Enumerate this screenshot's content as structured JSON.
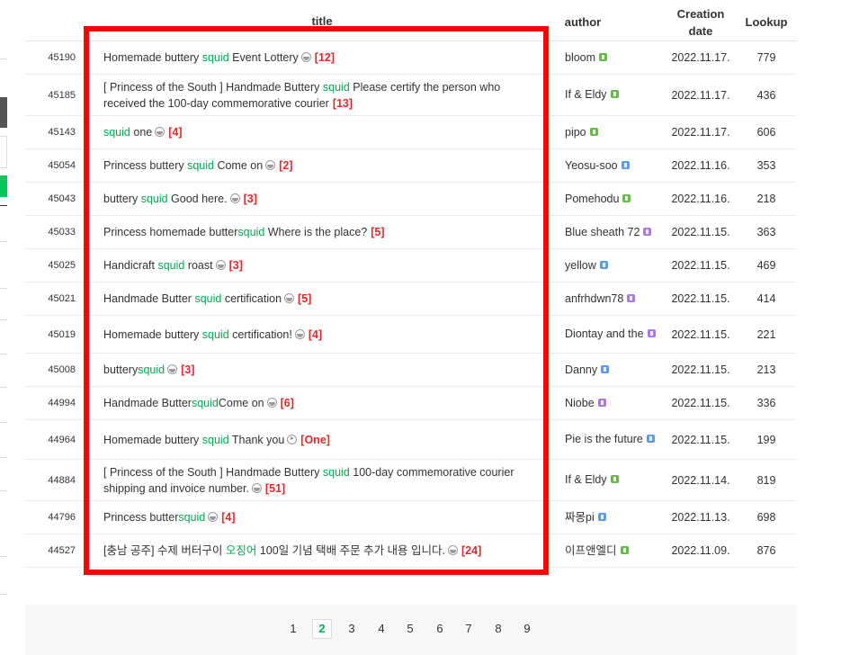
{
  "header": {
    "title": "title",
    "author": "author",
    "date": "Creation date",
    "lookup": "Lookup"
  },
  "colors": {
    "keyword": "#03a94f",
    "comment_count": "#e02a2a",
    "highlight_box": "#ff0000",
    "badge_green": "#6ab84d",
    "badge_blue": "#5d9ce8",
    "badge_purple": "#a77ce0"
  },
  "rows": [
    {
      "num": "45190",
      "title": [
        {
          "t": "Homemade buttery "
        },
        {
          "t": "squid",
          "hl": true
        },
        {
          "t": " Event Lottery"
        }
      ],
      "icon": "image-icon",
      "comments": "[12]",
      "author": "bloom",
      "badge": "green",
      "date": "2022.11.17.",
      "views": "779"
    },
    {
      "num": "45185",
      "title": [
        {
          "t": "[ Princess of the South ] Handmade Buttery "
        },
        {
          "t": "squid",
          "hl": true
        },
        {
          "t": " Please certify the person who received the 100-day commemorative courier"
        }
      ],
      "icon": "",
      "comments": "[13]",
      "author": "If & Eldy",
      "badge": "green",
      "date": "2022.11.17.",
      "views": "436"
    },
    {
      "num": "45143",
      "title": [
        {
          "t": "squid",
          "hl": true
        },
        {
          "t": " one"
        }
      ],
      "icon": "image-icon",
      "comments": "[4]",
      "author": "pipo",
      "badge": "green",
      "date": "2022.11.17.",
      "views": "606"
    },
    {
      "num": "45054",
      "title": [
        {
          "t": "Princess buttery "
        },
        {
          "t": "squid",
          "hl": true
        },
        {
          "t": " Come on"
        }
      ],
      "icon": "image-icon",
      "comments": "[2]",
      "author": "Yeosu-soo",
      "badge": "blue",
      "date": "2022.11.16.",
      "views": "353"
    },
    {
      "num": "45043",
      "title": [
        {
          "t": "buttery "
        },
        {
          "t": "squid",
          "hl": true
        },
        {
          "t": " Good here."
        }
      ],
      "icon": "image-icon",
      "comments": "[3]",
      "author": "Pomehodu",
      "badge": "green",
      "date": "2022.11.16.",
      "views": "218"
    },
    {
      "num": "45033",
      "title": [
        {
          "t": "Princess homemade butter"
        },
        {
          "t": "squid",
          "hl": true
        },
        {
          "t": " Where is the place?"
        }
      ],
      "icon": "",
      "comments": "[5]",
      "author": "Blue sheath 72",
      "badge": "purple",
      "date": "2022.11.15.",
      "views": "363"
    },
    {
      "num": "45025",
      "title": [
        {
          "t": "Handicraft "
        },
        {
          "t": "squid",
          "hl": true
        },
        {
          "t": " roast"
        }
      ],
      "icon": "image-icon",
      "comments": "[3]",
      "author": "yellow",
      "badge": "blue",
      "date": "2022.11.15.",
      "views": "469"
    },
    {
      "num": "45021",
      "title": [
        {
          "t": "Handmade Butter "
        },
        {
          "t": "squid",
          "hl": true
        },
        {
          "t": " certification"
        }
      ],
      "icon": "image-icon",
      "comments": "[5]",
      "author": "anfrhdwn78",
      "badge": "purple",
      "date": "2022.11.15.",
      "views": "414"
    },
    {
      "num": "45019",
      "title": [
        {
          "t": "Homemade buttery "
        },
        {
          "t": "squid",
          "hl": true
        },
        {
          "t": " certification!"
        }
      ],
      "icon": "image-icon",
      "comments": "[4]",
      "author": "Diontay and the",
      "badge": "purple",
      "date": "2022.11.15.",
      "views": "221"
    },
    {
      "num": "45008",
      "title": [
        {
          "t": "buttery"
        },
        {
          "t": "squid",
          "hl": true
        }
      ],
      "icon": "image-icon",
      "comments": "[3]",
      "author": "Danny",
      "badge": "blue",
      "date": "2022.11.15.",
      "views": "213"
    },
    {
      "num": "44994",
      "title": [
        {
          "t": "Handmade Butter"
        },
        {
          "t": "squid",
          "hl": true
        },
        {
          "t": "Come on"
        }
      ],
      "icon": "image-icon",
      "comments": "[6]",
      "author": "Niobe",
      "badge": "purple",
      "date": "2022.11.15.",
      "views": "336"
    },
    {
      "num": "44964",
      "title": [
        {
          "t": "Homemade buttery "
        },
        {
          "t": "squid",
          "hl": true
        },
        {
          "t": " Thank you"
        }
      ],
      "icon": "video-icon",
      "comments": "[One]",
      "author": "Pie is the future",
      "badge": "blue",
      "date": "2022.11.15.",
      "views": "199"
    },
    {
      "num": "44884",
      "title": [
        {
          "t": "[ Princess of the South ] Handmade Buttery "
        },
        {
          "t": "squid",
          "hl": true
        },
        {
          "t": " 100-day commemorative courier shipping and invoice number."
        }
      ],
      "icon": "image-icon",
      "comments": "[51]",
      "author": "If & Eldy",
      "badge": "green",
      "date": "2022.11.14.",
      "views": "819"
    },
    {
      "num": "44796",
      "title": [
        {
          "t": "Princess butter"
        },
        {
          "t": "squid",
          "hl": true
        }
      ],
      "icon": "image-icon",
      "comments": "[4]",
      "author": "짜몽pi",
      "badge": "blue",
      "date": "2022.11.13.",
      "views": "698"
    },
    {
      "num": "44527",
      "title": [
        {
          "t": "[충남 공주] 수제 버터구이 "
        },
        {
          "t": "오징어",
          "hl": true
        },
        {
          "t": " 100일 기념 택배 주문 추가 내용 입니다."
        }
      ],
      "icon": "image-icon",
      "comments": "[24]",
      "author": "이프앤엘디",
      "badge": "green",
      "date": "2022.11.09.",
      "views": "876"
    }
  ],
  "pagination": {
    "pages": [
      "1",
      "2",
      "3",
      "4",
      "5",
      "6",
      "7",
      "8",
      "9"
    ],
    "current": "2"
  }
}
